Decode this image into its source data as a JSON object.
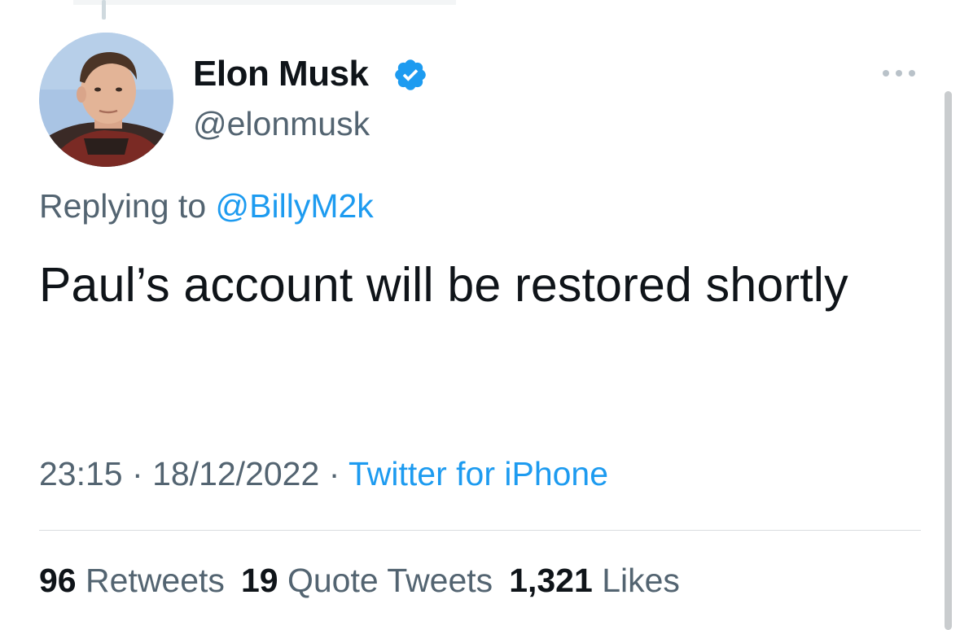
{
  "author": {
    "display_name": "Elon Musk",
    "handle": "@elonmusk",
    "verified": true,
    "avatar_icon": "profile-photo"
  },
  "menu_icon": "more-horizontal-icon",
  "reply": {
    "prefix": "Replying to",
    "mention": "@BillyM2k"
  },
  "tweet": {
    "text": "Paul’s account will be restored shortly"
  },
  "meta": {
    "time": "23:15",
    "separator": "·",
    "date": "18/12/2022",
    "source": "Twitter for iPhone"
  },
  "stats": {
    "retweets_count": "96",
    "retweets_label": "Retweets",
    "quotes_count": "19",
    "quotes_label": "Quote Tweets",
    "likes_count": "1,321",
    "likes_label": "Likes"
  },
  "colors": {
    "link": "#1d9bf0",
    "text": "#0f1419",
    "secondary": "#536471",
    "verified_badge": "#1d9bf0"
  }
}
